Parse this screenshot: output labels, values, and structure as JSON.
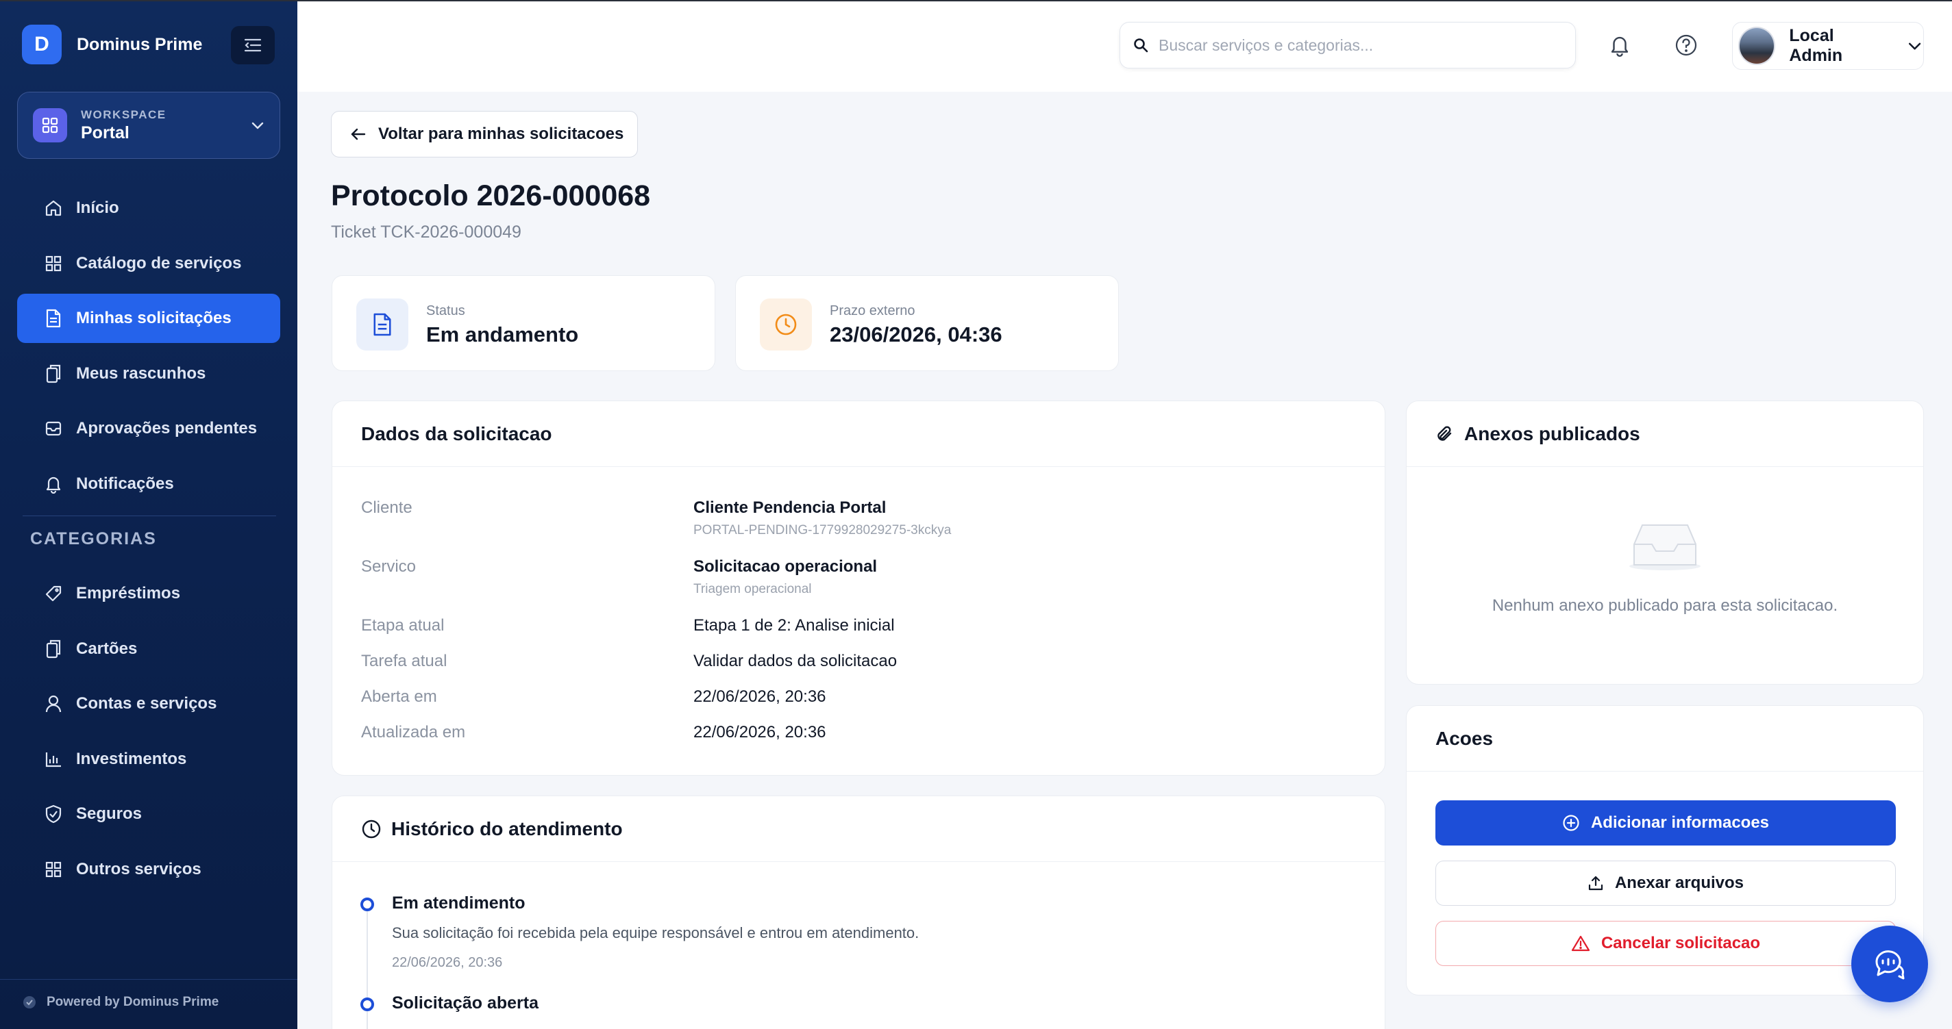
{
  "brand": {
    "logo_letter": "D",
    "name": "Dominus Prime"
  },
  "workspace": {
    "label": "WORKSPACE",
    "value": "Portal"
  },
  "nav": {
    "items": [
      {
        "label": "Início",
        "icon": "home-icon"
      },
      {
        "label": "Catálogo de serviços",
        "icon": "grid-icon"
      },
      {
        "label": "Minhas solicitações",
        "icon": "document-icon",
        "active": true
      },
      {
        "label": "Meus rascunhos",
        "icon": "copy-icon"
      },
      {
        "label": "Aprovações pendentes",
        "icon": "inbox-icon"
      },
      {
        "label": "Notificações",
        "icon": "bell-icon"
      }
    ],
    "categories_title": "CATEGORIAS",
    "categories": [
      {
        "label": "Empréstimos",
        "icon": "tag-icon"
      },
      {
        "label": "Cartões",
        "icon": "copy-icon"
      },
      {
        "label": "Contas e serviços",
        "icon": "user-icon"
      },
      {
        "label": "Investimentos",
        "icon": "bar-chart-icon"
      },
      {
        "label": "Seguros",
        "icon": "shield-check-icon"
      },
      {
        "label": "Outros serviços",
        "icon": "grid-icon"
      }
    ]
  },
  "footer": {
    "powered": "Powered by Dominus Prime"
  },
  "search": {
    "placeholder": "Buscar serviços e categorias..."
  },
  "user": {
    "name": "Local Admin"
  },
  "back_button": "Voltar para minhas solicitacoes",
  "page": {
    "title": "Protocolo 2026-000068",
    "subtitle": "Ticket TCK-2026-000049"
  },
  "stats": {
    "status": {
      "label": "Status",
      "value": "Em andamento"
    },
    "deadline": {
      "label": "Prazo externo",
      "value": "23/06/2026, 04:36"
    }
  },
  "details": {
    "title": "Dados da solicitacao",
    "rows": [
      {
        "label": "Cliente",
        "value": "Cliente Pendencia Portal",
        "sub": "PORTAL-PENDING-1779928029275-3kckya"
      },
      {
        "label": "Servico",
        "value": "Solicitacao operacional",
        "sub": "Triagem operacional"
      },
      {
        "label": "Etapa atual",
        "value": "Etapa 1 de 2: Analise inicial"
      },
      {
        "label": "Tarefa atual",
        "value": "Validar dados da solicitacao"
      },
      {
        "label": "Aberta em",
        "value": "22/06/2026, 20:36"
      },
      {
        "label": "Atualizada em",
        "value": "22/06/2026, 20:36"
      }
    ]
  },
  "history": {
    "title": "Histórico do atendimento",
    "events": [
      {
        "title": "Em atendimento",
        "desc": "Sua solicitação foi recebida pela equipe responsável e entrou em atendimento.",
        "date": "22/06/2026, 20:36"
      },
      {
        "title": "Solicitação aberta"
      }
    ]
  },
  "attachments": {
    "title": "Anexos publicados",
    "empty": "Nenhum anexo publicado para esta solicitacao."
  },
  "actions": {
    "title": "Acoes",
    "add_info": "Adicionar informacoes",
    "attach": "Anexar arquivos",
    "cancel": "Cancelar solicitacao"
  },
  "colors": {
    "primary": "#1d4ed8",
    "sidebar": "#0f2a5c",
    "danger": "#e11d2c",
    "warning": "#f28c18"
  }
}
